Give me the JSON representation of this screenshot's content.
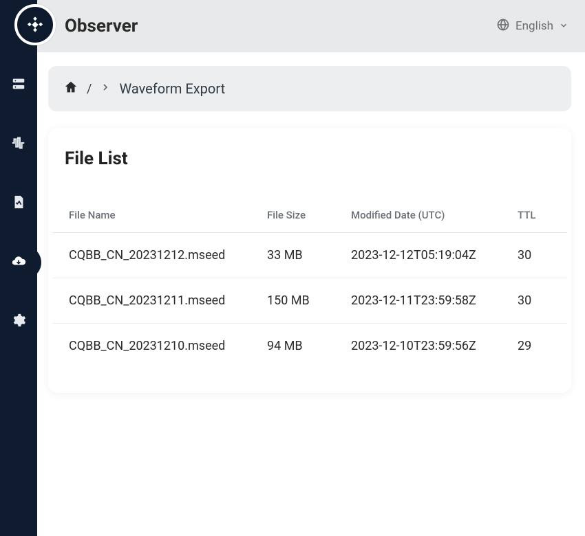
{
  "header": {
    "app_title": "Observer",
    "language_label": "English"
  },
  "breadcrumb": {
    "current": "Waveform Export"
  },
  "panel": {
    "title": "File List"
  },
  "table": {
    "headers": {
      "name": "File Name",
      "size": "File Size",
      "modified": "Modified Date (UTC)",
      "ttl": "TTL"
    },
    "rows": [
      {
        "name": "CQBB_CN_20231212.mseed",
        "size": "33 MB",
        "modified": "2023-12-12T05:19:04Z",
        "ttl": "30"
      },
      {
        "name": "CQBB_CN_20231211.mseed",
        "size": "150 MB",
        "modified": "2023-12-11T23:59:58Z",
        "ttl": "30"
      },
      {
        "name": "CQBB_CN_20231210.mseed",
        "size": "94 MB",
        "modified": "2023-12-10T23:59:56Z",
        "ttl": "29"
      }
    ]
  },
  "sidebar": {
    "items": [
      {
        "icon": "server-icon"
      },
      {
        "icon": "waveform-icon"
      },
      {
        "icon": "file-chart-icon"
      },
      {
        "icon": "cloud-download-icon"
      },
      {
        "icon": "gear-icon"
      }
    ],
    "active_index": 3
  }
}
